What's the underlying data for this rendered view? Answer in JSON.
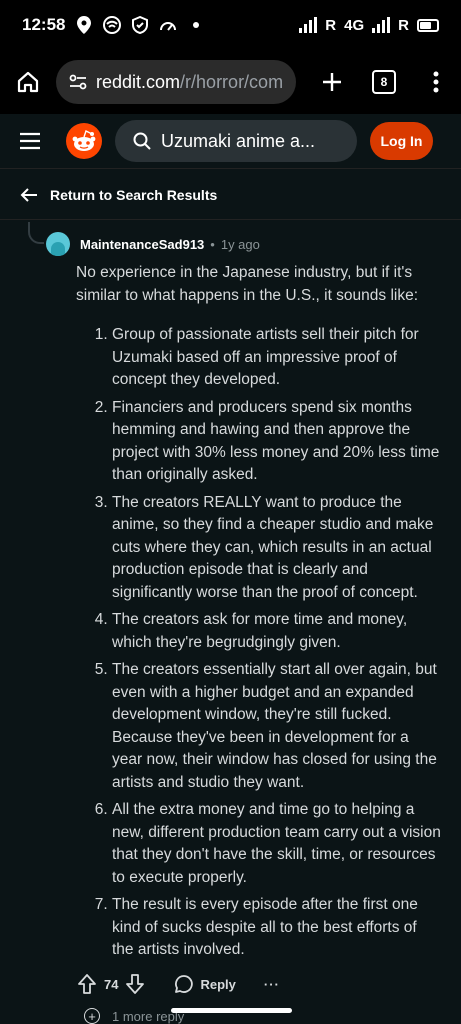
{
  "status_bar": {
    "time": "12:58",
    "network": "4G",
    "roaming_mark": "R"
  },
  "browser": {
    "url_host": "reddit.com",
    "url_path": "/r/horror/com",
    "tab_count": "8"
  },
  "header": {
    "search_text": "Uzumaki anime a...",
    "login_label": "Log In"
  },
  "back_bar": {
    "label": "Return to Search Results"
  },
  "comment": {
    "author": "MaintenanceSad913",
    "separator": "•",
    "age": "1y ago",
    "intro": "No experience in the Japanese industry, but if it's similar to what happens in the U.S., it sounds like:",
    "items": [
      "Group of passionate artists sell their pitch for Uzumaki based off an impressive proof of concept they developed.",
      "Financiers and producers spend six months hemming and hawing and then approve the project with 30% less money and 20% less time than originally asked.",
      "The creators REALLY want to produce the anime, so they find a cheaper studio and make cuts where they can, which results in an actual production episode that is clearly and significantly worse than the proof of concept.",
      "The creators ask for more time and money, which they're begrudgingly given.",
      "The creators essentially start all over again, but even with a higher budget and an expanded development window, they're still fucked. Because they've been in development for a year now, their window has closed for using the artists and studio they want.",
      "All the extra money and time go to helping a new, different production team carry out a vision that they don't have the skill, time, or resources to execute properly.",
      "The result is every episode after the first one kind of sucks despite all to the best efforts of the artists involved."
    ],
    "score": "74",
    "reply_label": "Reply",
    "more_label": "···",
    "more_replies": "1 more reply"
  },
  "colors": {
    "background": "#0b1416",
    "accent": "#d93a00",
    "search_bg": "#2a3236"
  }
}
